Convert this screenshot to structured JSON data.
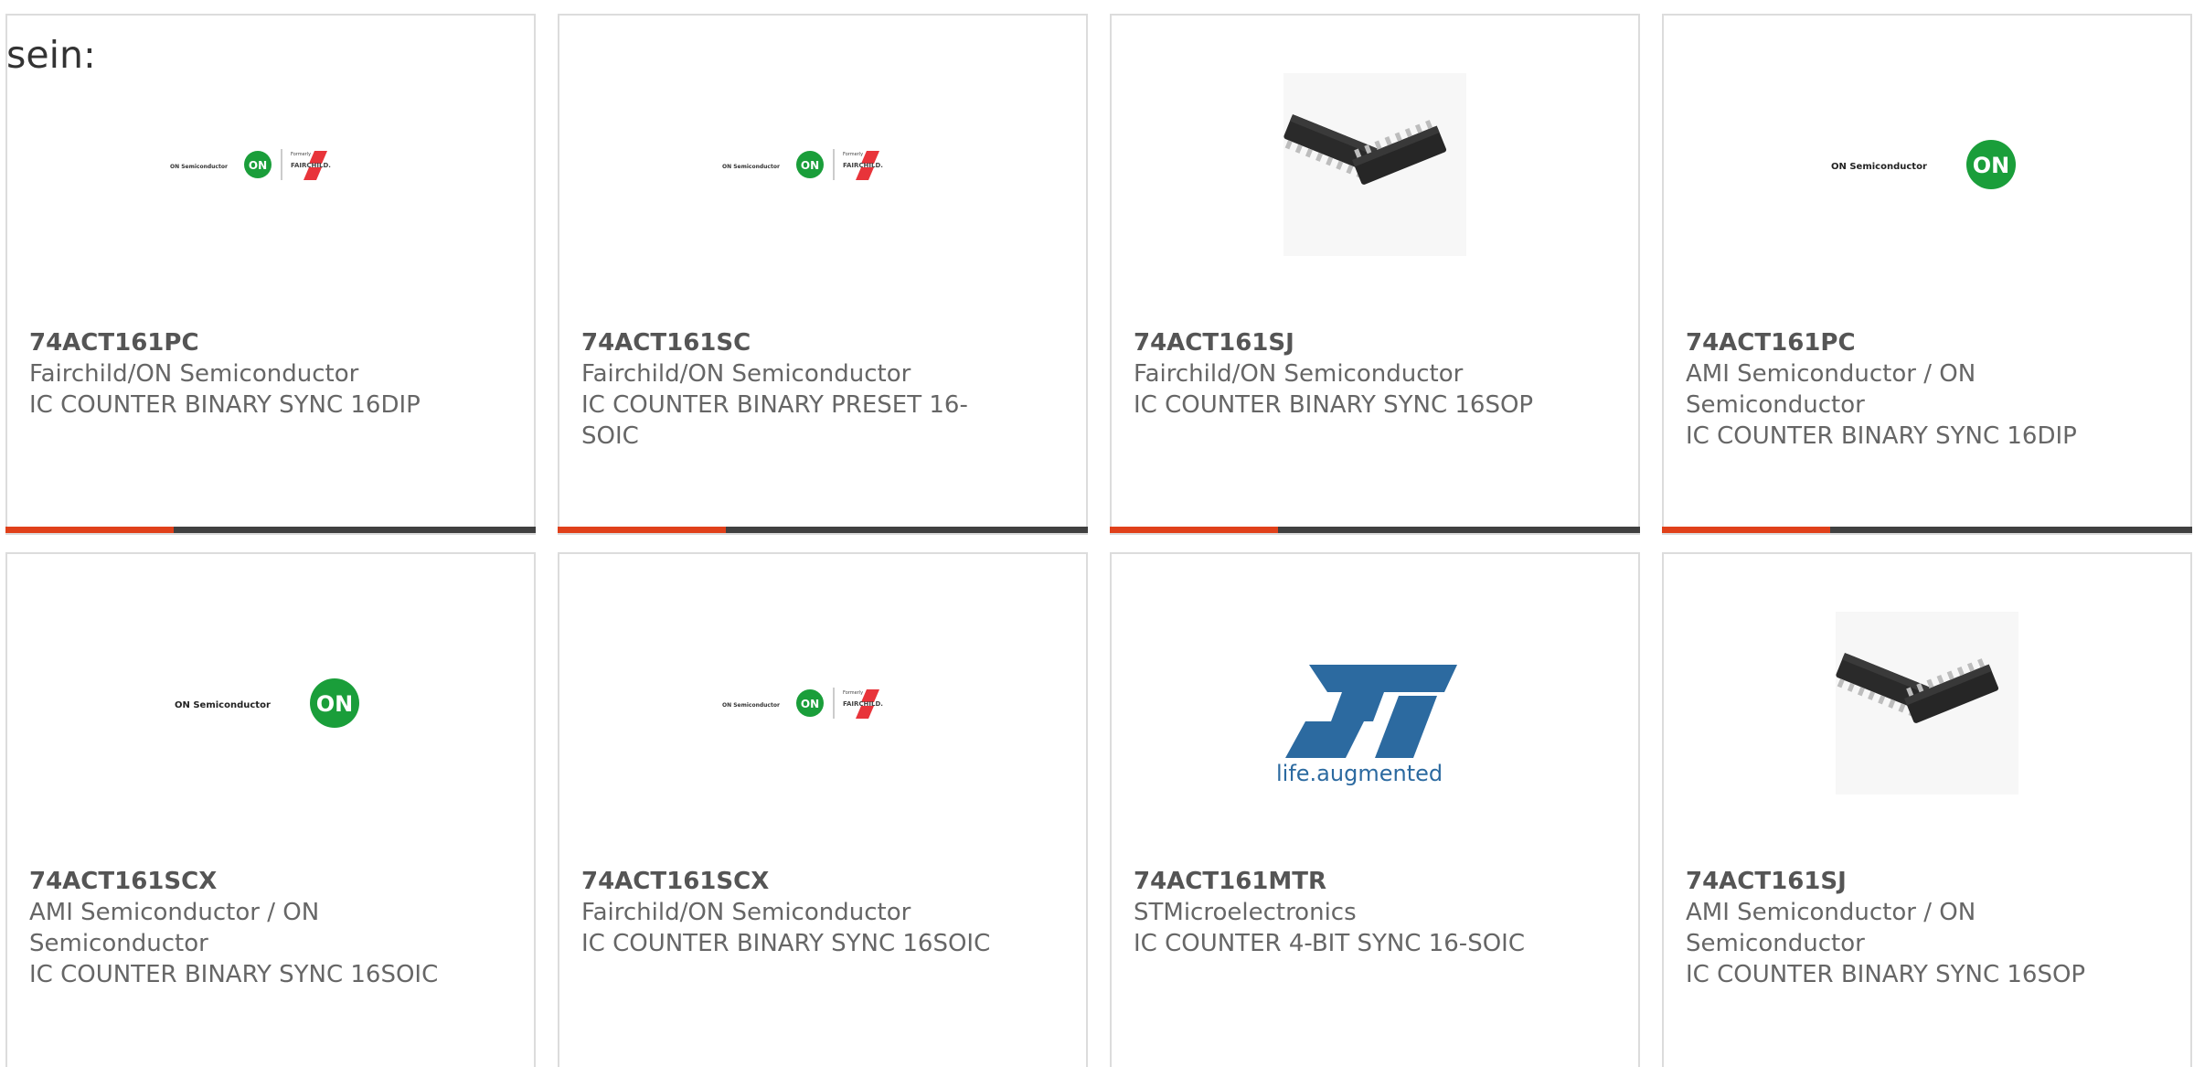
{
  "intro_text": "sein:",
  "colors": {
    "accent": "#e0401a",
    "bar_dark": "#404040",
    "on_green": "#1a9e3a",
    "fairchild_red": "#e8343a",
    "st_blue": "#2c6aa0"
  },
  "logos": {
    "on_small": "ON Semiconductor",
    "on_large": "ON Semiconductor",
    "on_mark": "ON",
    "formerly": "Formerly",
    "fairchild": "FAIRCHILD.",
    "st_tagline": "life.augmented"
  },
  "products": [
    {
      "part": "74ACT161PC",
      "maker": "Fairchild/ON Semiconductor",
      "desc": "IC COUNTER BINARY SYNC 16DIP",
      "image": "on-fairchild-logo"
    },
    {
      "part": "74ACT161SC",
      "maker": "Fairchild/ON Semiconductor",
      "desc": "IC COUNTER BINARY PRESET 16-SOIC",
      "image": "on-fairchild-logo"
    },
    {
      "part": "74ACT161SJ",
      "maker": "Fairchild/ON Semiconductor",
      "desc": "IC COUNTER BINARY SYNC 16SOP",
      "image": "soic-chip-photo"
    },
    {
      "part": "74ACT161PC",
      "maker": "AMI Semiconductor / ON Semiconductor",
      "desc": "IC COUNTER BINARY SYNC 16DIP",
      "image": "on-semiconductor-logo"
    },
    {
      "part": "74ACT161SCX",
      "maker": "AMI Semiconductor / ON Semiconductor",
      "desc": "IC COUNTER BINARY SYNC 16SOIC",
      "image": "on-semiconductor-logo"
    },
    {
      "part": "74ACT161SCX",
      "maker": "Fairchild/ON Semiconductor",
      "desc": "IC COUNTER BINARY SYNC 16SOIC",
      "image": "on-fairchild-logo"
    },
    {
      "part": "74ACT161MTR",
      "maker": "STMicroelectronics",
      "desc": "IC COUNTER 4-BIT SYNC 16-SOIC",
      "image": "st-logo"
    },
    {
      "part": "74ACT161SJ",
      "maker": "AMI Semiconductor / ON Semiconductor",
      "desc": "IC COUNTER BINARY SYNC 16SOP",
      "image": "soic-chip-photo"
    }
  ]
}
